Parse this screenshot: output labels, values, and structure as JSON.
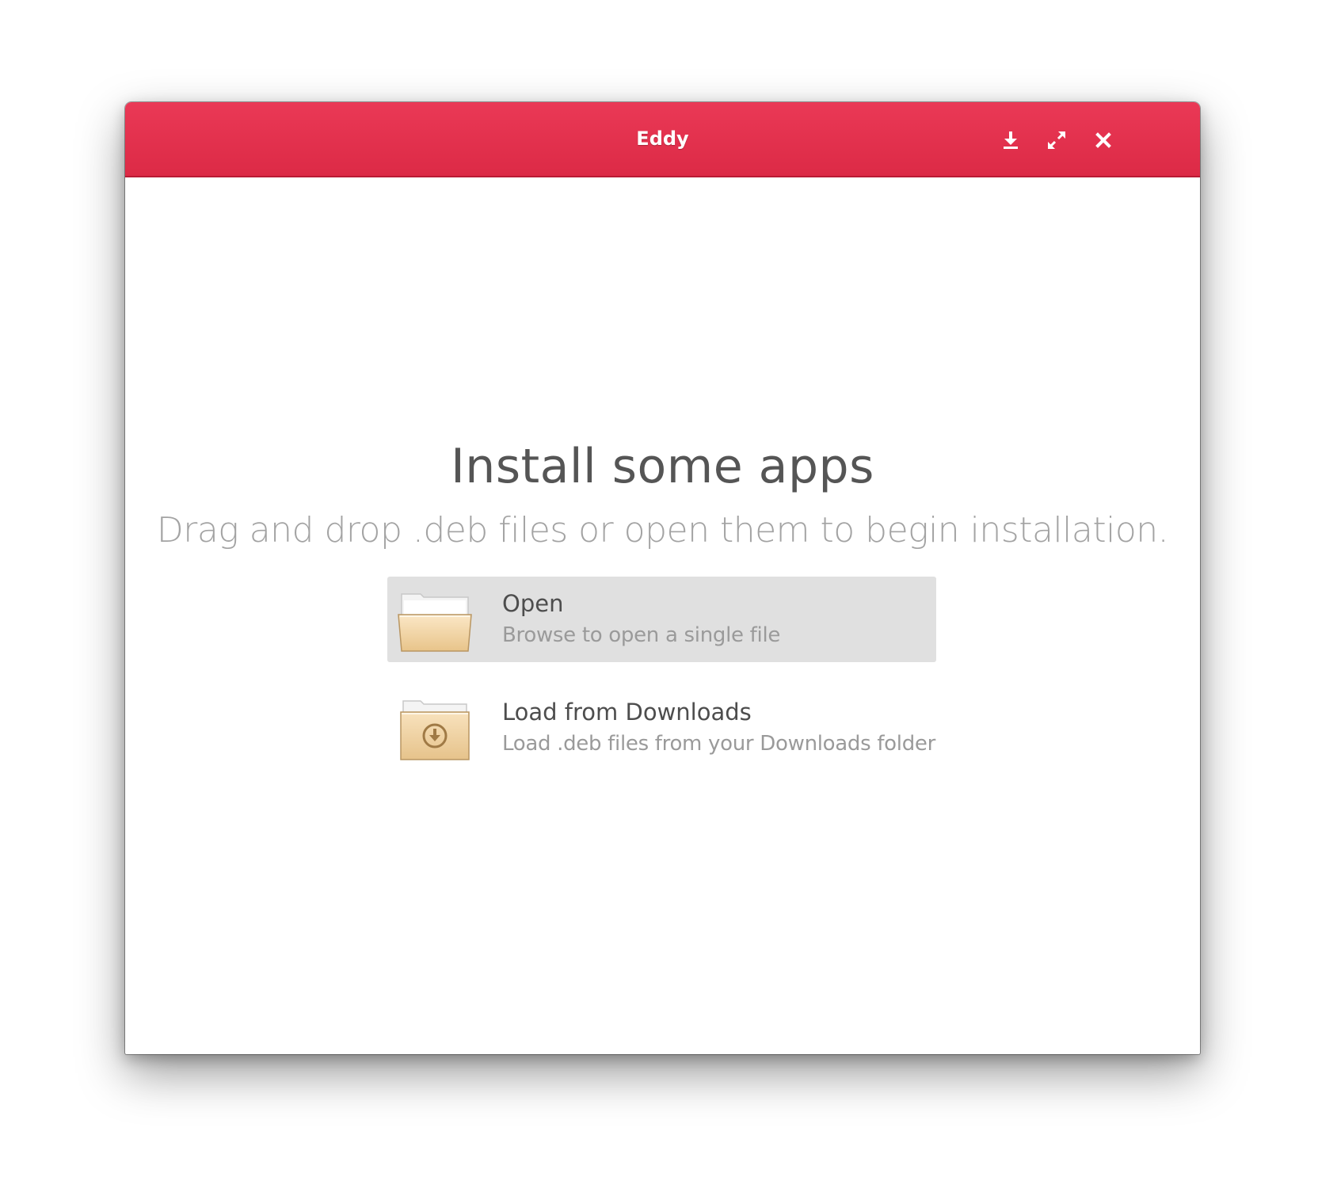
{
  "window": {
    "title": "Eddy",
    "accent_color": "#e2314d",
    "buttons": {
      "download_icon": "download-icon",
      "maximize_icon": "maximize-icon",
      "close_icon": "close-icon"
    }
  },
  "welcome": {
    "title": "Install some apps",
    "subtitle": "Drag and drop .deb files or open them to begin installation."
  },
  "actions": [
    {
      "icon": "folder-open-icon",
      "label": "Open",
      "description": "Browse to open a single file",
      "highlighted": true
    },
    {
      "icon": "folder-download-icon",
      "label": "Load from Downloads",
      "description": "Load .deb files from your Downloads folder",
      "highlighted": false
    }
  ]
}
